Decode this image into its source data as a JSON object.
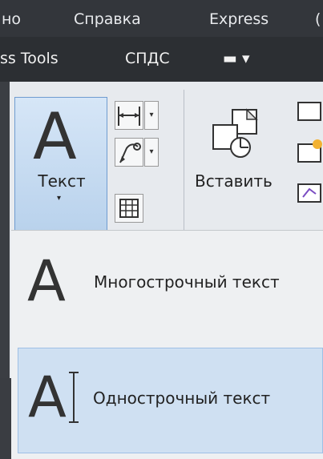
{
  "menubar": {
    "items": [
      "но",
      "Справка",
      "Express",
      "("
    ]
  },
  "tabs": {
    "items": [
      "ss Tools",
      "СПДС",
      "▬ ▾"
    ]
  },
  "ribbon": {
    "text_button": {
      "letter": "A",
      "label": "Текст",
      "arrow": "▾"
    },
    "dim_dropdown": "▾",
    "leader_dropdown": "▾",
    "insert_label": "Вставить"
  },
  "dropdown": {
    "items": [
      {
        "letter": "A",
        "label": "Многострочный текст"
      },
      {
        "letter": "A",
        "label": "Однострочный текст"
      }
    ]
  }
}
